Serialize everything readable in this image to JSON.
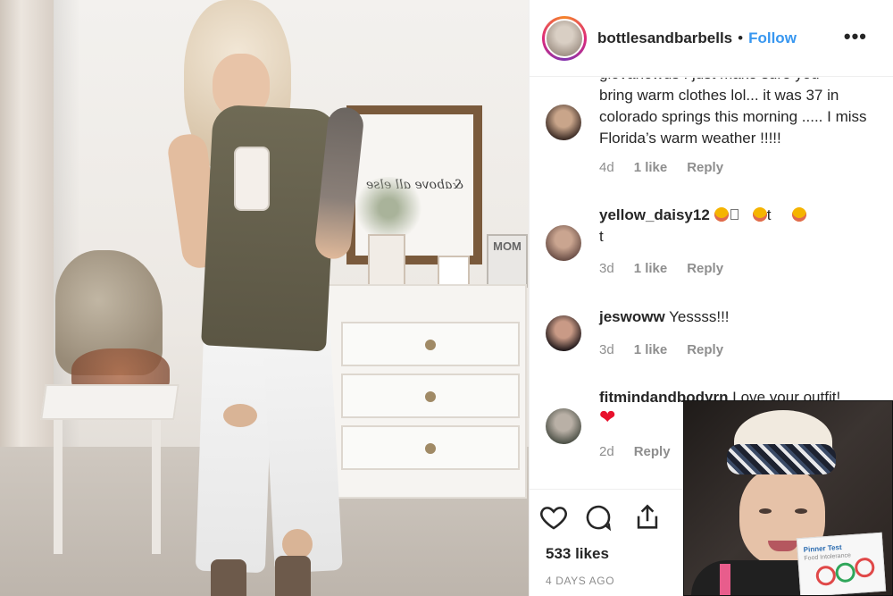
{
  "post": {
    "username": "bottlesandbarbells",
    "separator": "•",
    "follow_label": "Follow",
    "more_label": "•••"
  },
  "comments": [
    {
      "id": "c1",
      "username": "giovanowus",
      "clipped_line": "giovanowus I just make sure you",
      "text": "bring warm clothes lol... it was 37 in colorado springs this morning ..... I miss Florida’s warm weather !!!!!",
      "age": "4d",
      "likes": "1 like",
      "reply": "Reply"
    },
    {
      "id": "c2",
      "username": "yellow_daisy12",
      "text_a": "t",
      "text_b": "t",
      "age": "3d",
      "likes": "1 like",
      "reply": "Reply"
    },
    {
      "id": "c3",
      "username": "jeswoww",
      "text": "Yessss!!!",
      "age": "3d",
      "likes": "1 like",
      "reply": "Reply"
    },
    {
      "id": "c4",
      "username": "fitmindandbodyrn",
      "text": "Love your outfit!",
      "age": "2d",
      "reply": "Reply"
    }
  ],
  "actions": {
    "likes_count": "533 likes",
    "time_ago": "4 DAYS AGO",
    "icons": [
      "heart-icon",
      "comment-icon",
      "share-icon"
    ]
  },
  "photo": {
    "art_text": "&above all else",
    "mom_sign": "MOM"
  },
  "inset": {
    "box_title": "Pinner Test",
    "box_sub": "Food Intolerance"
  },
  "colors": {
    "follow": "#3897f0",
    "text": "#262626",
    "meta": "#8e8e8e",
    "heart": "#e8112d"
  }
}
